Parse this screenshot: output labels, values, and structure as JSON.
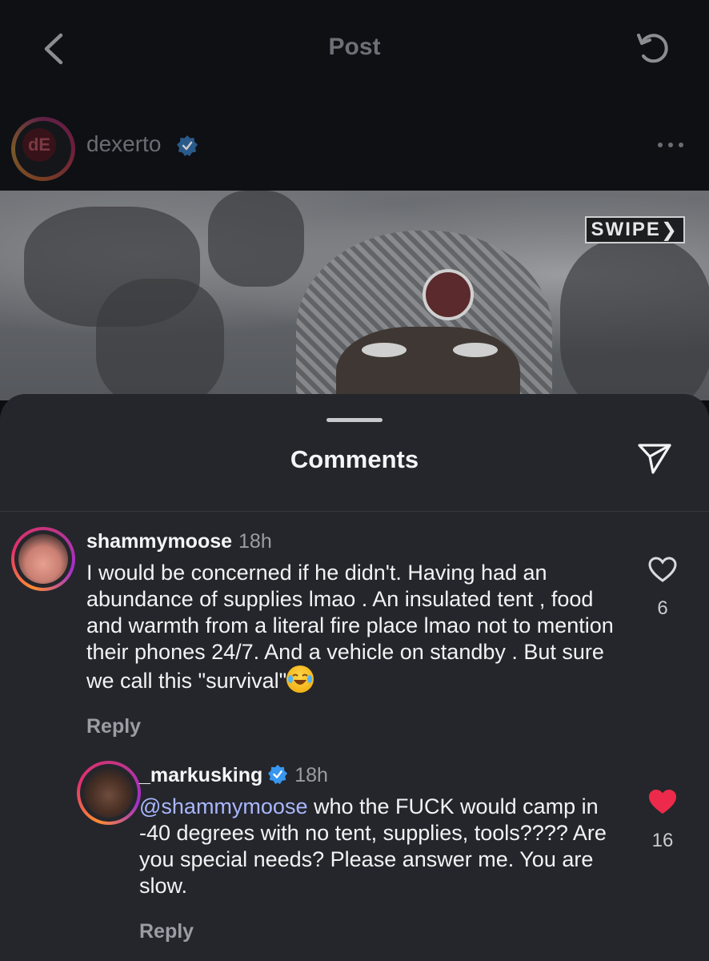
{
  "topbar": {
    "title": "Post"
  },
  "post": {
    "username": "dexerto",
    "avatar_initials": "dE",
    "swipe_label": "SWIPE"
  },
  "comments_sheet": {
    "title": "Comments",
    "comments": [
      {
        "username": "shammymoose",
        "time": "18h",
        "text": "I would be concerned if he didn't. Having  had an abundance of supplies lmao . An insulated tent , food and warmth from a literal fire place lmao not to mention their phones 24/7. And a vehicle on standby . But sure we call this \"survival\"",
        "emoji": "😂",
        "likes": "6",
        "liked": false,
        "reply_label": "Reply"
      },
      {
        "username": "_markusking",
        "verified": true,
        "time": "18h",
        "mention": "@shammymoose",
        "text": " who the FUCK would camp in -40 degrees with no tent, supplies, tools???? Are you special needs? Please answer me. You are slow.",
        "likes": "16",
        "liked": true,
        "reply_label": "Reply"
      }
    ]
  },
  "colors": {
    "background": "#0b0d10",
    "sheet": "#24262b",
    "liked_heart": "#ee2a4a",
    "mention": "#a9b7ff",
    "verified": "#3897f0"
  }
}
